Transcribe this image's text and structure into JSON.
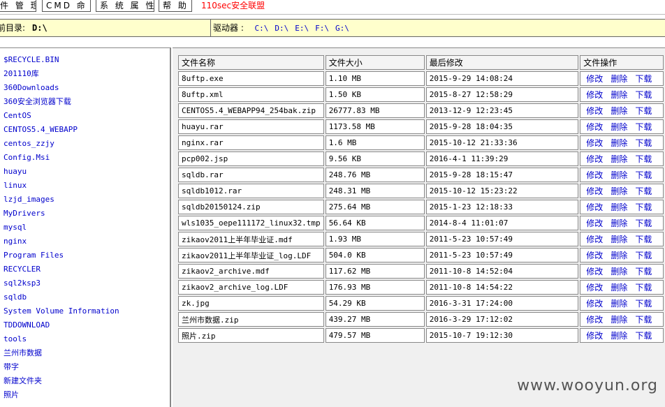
{
  "menu": {
    "items": [
      "件 管 理",
      "CMD 命 令",
      "系 统 属 性",
      "帮 助"
    ],
    "brand": "110sec安全联盟"
  },
  "pathbar": {
    "label": "前目录:",
    "current_dir": "D:\\",
    "drives_label": "驱动器 :",
    "drives": [
      "C:\\",
      "D:\\",
      "E:\\",
      "F:\\",
      "G:\\"
    ]
  },
  "sidebar": {
    "items": [
      "$RECYCLE.BIN",
      "201110库",
      "360Downloads",
      "360安全浏览器下载",
      "CentOS",
      "CENTOS5.4_WEBAPP",
      "centos_zzjy",
      "Config.Msi",
      "huayu",
      "linux",
      "lzjd_images",
      "MyDrivers",
      "mysql",
      "nginx",
      "Program Files",
      "RECYCLER",
      "sql2ksp3",
      "sqldb",
      "System Volume Information",
      "TDDOWNLOAD",
      "tools",
      "兰州市数据",
      "带字",
      "新建文件夹",
      "照片"
    ]
  },
  "table": {
    "headers": [
      "文件名称",
      "文件大小",
      "最后修改",
      "文件操作"
    ],
    "actions": [
      "修改",
      "删除",
      "下载"
    ],
    "rows": [
      {
        "name": "8uftp.exe",
        "size": "1.10 MB",
        "modified": "2015-9-29 14:08:24"
      },
      {
        "name": "8uftp.xml",
        "size": "1.50 KB",
        "modified": "2015-8-27 12:58:29"
      },
      {
        "name": "CENTOS5.4_WEBAPP94_254bak.zip",
        "size": "26777.83 MB",
        "modified": "2013-12-9 12:23:45"
      },
      {
        "name": "huayu.rar",
        "size": "1173.58 MB",
        "modified": "2015-9-28 18:04:35"
      },
      {
        "name": "nginx.rar",
        "size": "1.6 MB",
        "modified": "2015-10-12 21:33:36"
      },
      {
        "name": "pcp002.jsp",
        "size": "9.56 KB",
        "modified": "2016-4-1 11:39:29"
      },
      {
        "name": "sqldb.rar",
        "size": "248.76 MB",
        "modified": "2015-9-28 18:15:47"
      },
      {
        "name": "sqldb1012.rar",
        "size": "248.31 MB",
        "modified": "2015-10-12 15:23:22"
      },
      {
        "name": "sqldb20150124.zip",
        "size": "275.64 MB",
        "modified": "2015-1-23 12:18:33"
      },
      {
        "name": "wls1035_oepe111172_linux32.tmp",
        "size": "56.64 KB",
        "modified": "2014-8-4 11:01:07"
      },
      {
        "name": "zikaov2011上半年毕业证.mdf",
        "size": "1.93 MB",
        "modified": "2011-5-23 10:57:49"
      },
      {
        "name": "zikaov2011上半年毕业证_log.LDF",
        "size": "504.0 KB",
        "modified": "2011-5-23 10:57:49"
      },
      {
        "name": "zikaov2_archive.mdf",
        "size": "117.62 MB",
        "modified": "2011-10-8 14:52:04"
      },
      {
        "name": "zikaov2_archive_log.LDF",
        "size": "176.93 MB",
        "modified": "2011-10-8 14:54:22"
      },
      {
        "name": "zk.jpg",
        "size": "54.29 KB",
        "modified": "2016-3-31 17:24:00"
      },
      {
        "name": "兰州市数据.zip",
        "size": "439.27 MB",
        "modified": "2016-3-29 17:12:02"
      },
      {
        "name": "照片.zip",
        "size": "479.57 MB",
        "modified": "2015-10-7 19:12:30"
      }
    ]
  },
  "watermark": "www.wooyun.org"
}
